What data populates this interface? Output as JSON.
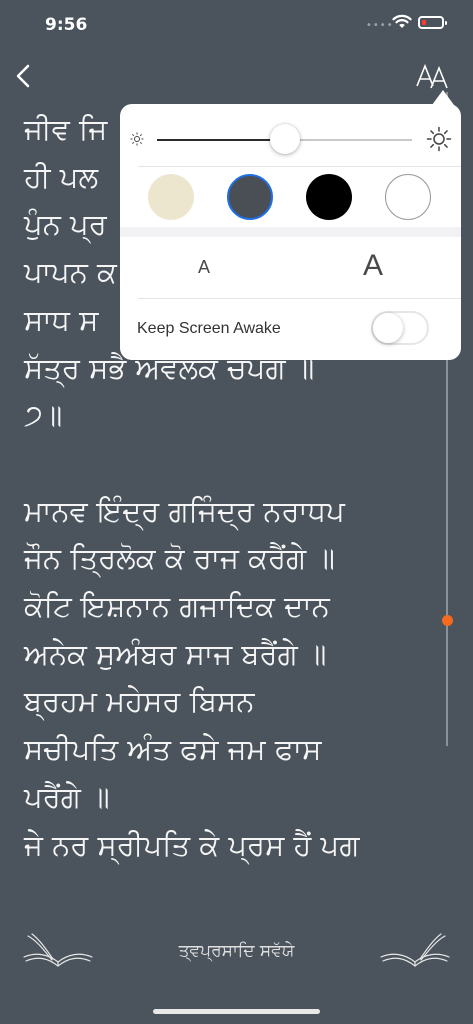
{
  "status_bar": {
    "time": "9:56",
    "battery_level": 0.1
  },
  "nav": {
    "back_icon": "chevron-left-icon",
    "font_settings_icon": "text-size-icon"
  },
  "bani_text": "ਜੀਵ ਜਿ\nਹੀ ਪਲ\nਪੁੰਨ ਪ੍ਰ\nਪਾਪਨ ਕ\nਸਾਧ ਸ\nਸੱਤ੍ਰ ਸਭੈ ਅਵਲੋਕ ਚਪੈਂਗੇ ॥\n੭॥\n\nਮਾਨਵ ਇੰਦ੍ਰ ਗਜਿੰਦ੍ਰ ਨਰਾਧਪ\nਜੌਨ ਤ੍ਰਿਲੋਕ ਕੋ ਰਾਜ ਕਰੈਂਗੇ ॥\nਕੋਟਿ ਇਸ਼ਨਾਨ ਗਜਾਦਿਕ ਦਾਨ\nਅਨੇਕ ਸੁਅੰਬਰ ਸਾਜ ਬਰੈਂਗੇ ॥\nਬ੍ਰਹਮ ਮਹੇਸਰ ਬਿਸਨ\nਸਚੀਪਤਿ ਅੰਤ ਫਸੇ ਜਮ ਫਾਸ\nਪਰੈਂਗੇ ॥\nਜੇ ਨਰ ਸ੍ਰੀਪਤਿ ਕੇ ਪ੍ਰਸ ਹੈਂ ਪਗ",
  "reading_progress": 0.82,
  "settings_popover": {
    "brightness": 0.5,
    "themes": [
      {
        "name": "sepia",
        "color": "#ede6cf",
        "selected": false
      },
      {
        "name": "dark-gray",
        "color": "#4a4f55",
        "selected": true
      },
      {
        "name": "black",
        "color": "#000000",
        "selected": false
      },
      {
        "name": "white",
        "color": "#ffffff",
        "selected": false
      }
    ],
    "font_small_label": "A",
    "font_large_label": "A",
    "keep_awake_label": "Keep Screen Awake",
    "keep_awake_on": false
  },
  "footer": {
    "title": "ਤ੍ਵਪ੍ਰਸਾਦਿ ਸਵੱਯੇ"
  },
  "colors": {
    "background": "#4b545c",
    "accent": "#f46a1f",
    "selected_ring": "#1f6fe6"
  }
}
